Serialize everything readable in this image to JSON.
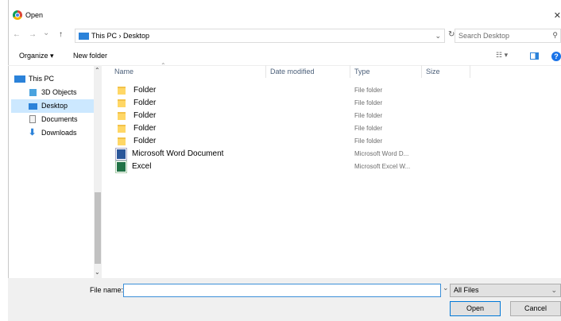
{
  "window": {
    "title": "Open",
    "close": "✕"
  },
  "nav": {
    "back": "←",
    "forward": "→",
    "history": "⌄",
    "up": "↑",
    "breadcrumb": "This PC  ›  Desktop",
    "refresh": "↻",
    "search_placeholder": "Search Desktop"
  },
  "toolbar": {
    "organize": "Organize ▾",
    "new_folder": "New folder"
  },
  "sidebar": {
    "items": [
      {
        "label": "This PC",
        "icon": "computer-icon"
      },
      {
        "label": "3D Objects",
        "icon": "cube-icon"
      },
      {
        "label": "Desktop",
        "icon": "desktop-icon",
        "selected": true
      },
      {
        "label": "Documents",
        "icon": "document-icon"
      },
      {
        "label": "Downloads",
        "icon": "download-icon"
      }
    ]
  },
  "columns": {
    "name": "Name",
    "date": "Date modified",
    "type": "Type",
    "size": "Size"
  },
  "files": [
    {
      "name": "Folder",
      "type": "File folder",
      "icon": "folder-icon"
    },
    {
      "name": "Folder",
      "type": "File folder",
      "icon": "folder-icon"
    },
    {
      "name": "Folder",
      "type": "File folder",
      "icon": "folder-icon"
    },
    {
      "name": "Folder",
      "type": "File folder",
      "icon": "folder-icon"
    },
    {
      "name": "Folder",
      "type": "File folder",
      "icon": "folder-icon"
    },
    {
      "name": "Microsoft Word Document",
      "type": "Microsoft Word D...",
      "icon": "word-icon"
    },
    {
      "name": "Excel",
      "type": "Microsoft Excel W...",
      "icon": "excel-icon"
    }
  ],
  "footer": {
    "file_name_label": "File name:",
    "file_name_value": "",
    "file_type": "All Files",
    "open": "Open",
    "cancel": "Cancel"
  }
}
